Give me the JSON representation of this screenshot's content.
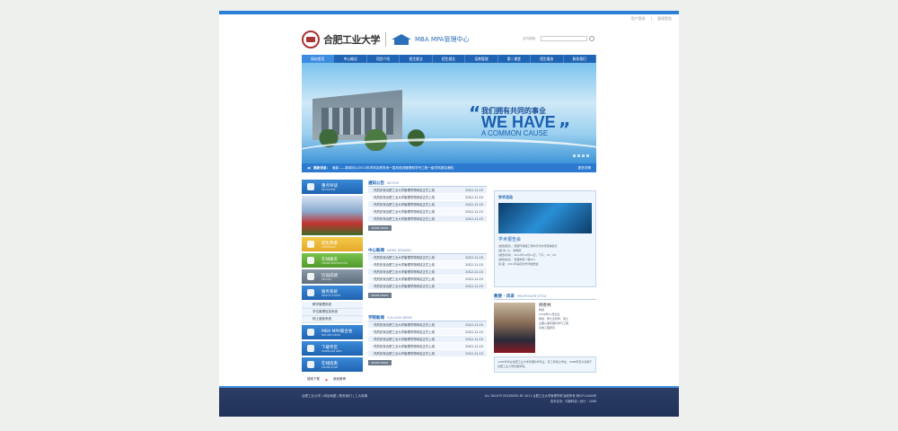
{
  "toplinks": [
    "用户登录",
    "|",
    "管理登陆"
  ],
  "header": {
    "university": "合肥工业大学",
    "center": "MBA MPA管理中心",
    "search_label": "站内搜索："
  },
  "nav": [
    "网站首页",
    "中心概况",
    "项目介绍",
    "招生就业",
    "招生就业",
    "培养管理",
    "第二课堂",
    "招生服务",
    "联系我们"
  ],
  "banner": {
    "slogan_cn": "我们拥有共同的事业",
    "slogan_en_1": "WE HAVE",
    "slogan_en_2": "A COMMON CAUSE",
    "ticker_label": "最新消息：",
    "ticker_text": "最新——新闻中心2012年学科名称查询一直到收到管理和学号工程一级学科报名通知",
    "ticker_more": "更多详情"
  },
  "sidebar": {
    "buttons": [
      {
        "label": "重点导读",
        "sub": "NAVIGATION"
      },
      {
        "label": "招生简章",
        "sub": "ADMISSIONS"
      },
      {
        "label": "在线报名",
        "sub": "ONLINE REGISTRATION"
      },
      {
        "label": "历届成绩",
        "sub": "RESULTS"
      },
      {
        "label": "服务系统",
        "sub": "SERVICE SYSTEM"
      }
    ],
    "subitems": [
      "教学管理系统",
      "学位管理信息系统",
      "网上缴费系统"
    ],
    "buttons2": [
      {
        "label": "MBA MPA联合会",
        "sub": "MBA MPA UNION"
      },
      {
        "label": "下载专区",
        "sub": "DOWNLOAD AREA"
      },
      {
        "label": "在线指南",
        "sub": "ONLINE GUIDE"
      }
    ],
    "share": [
      "搜索下载",
      "新浪微博"
    ]
  },
  "notice": {
    "title": "通知公告",
    "title_en": "NOTICE",
    "rows": [
      {
        "text": "· 热烈庆祝合肥工业大学管理学院网站正式上线",
        "date": "2012-11-15"
      },
      {
        "text": "· 热烈庆祝合肥工业大学管理学院网站正式上线",
        "date": "2012-11-15"
      },
      {
        "text": "· 热烈庆祝合肥工业大学管理学院网站正式上线",
        "date": "2012-11-15"
      },
      {
        "text": "· 热烈庆祝合肥工业大学管理学院网站正式上线",
        "date": "2012-11-15"
      },
      {
        "text": "· 热烈庆祝合肥工业大学管理学院网站正式上线",
        "date": "2012-11-15"
      }
    ],
    "more": "MORE NEWS"
  },
  "news": {
    "title": "中心新闻",
    "title_en": "NEWS DYNAMIC",
    "rows": [
      {
        "text": "· 热烈庆祝合肥工业大学管理学院网站正式上线",
        "date": "2012-11-15"
      },
      {
        "text": "· 热烈庆祝合肥工业大学管理学院网站正式上线",
        "date": "2012-11-15"
      },
      {
        "text": "· 热烈庆祝合肥工业大学管理学院网站正式上线",
        "date": "2012-11-15"
      },
      {
        "text": "· 热烈庆祝合肥工业大学管理学院网站正式上线",
        "date": "2012-11-15"
      },
      {
        "text": "· 热烈庆祝合肥工业大学管理学院网站正式上线",
        "date": "2012-11-15"
      }
    ],
    "more": "MORE NEWS"
  },
  "college": {
    "title": "学院新闻",
    "title_en": "COLLEGE NEWS",
    "rows": [
      {
        "text": "· 热烈庆祝合肥工业大学管理学院网站正式上线",
        "date": "2012-11-15"
      },
      {
        "text": "· 热烈庆祝合肥工业大学管理学院网站正式上线",
        "date": "2012-11-15"
      },
      {
        "text": "· 热烈庆祝合肥工业大学管理学院网站正式上线",
        "date": "2012-11-15"
      },
      {
        "text": "· 热烈庆祝合肥工业大学管理学院网站正式上线",
        "date": "2012-11-15"
      },
      {
        "text": "· 热烈庆祝合肥工业大学管理学院网站正式上线",
        "date": "2012-11-15"
      }
    ],
    "more": "MORE NEWS"
  },
  "activity": {
    "title": "学术活动",
    "name": "学术报告会",
    "lines": [
      "[报告题目]：低碳环保理工场时代与市场营销模式",
      "[报 告 人]：朱教授",
      "[报告时间]：2012年10月11日，下午：15：00",
      "[报告地点]：管理学院一楼101",
      "讲    座：2012年第四次学术报告会"
    ]
  },
  "professor": {
    "title": "教授 · 风采",
    "title_en": "PROFESSOR STYLE",
    "name": "杨善林",
    "role": "教授",
    "lines": [
      "1948年10月出生",
      "教授、博士生导师、院士",
      "主要从事管理科学与工程",
      "系统工程研究"
    ],
    "bio": "1985年毕业合肥工业大学管理科学专业，获工学硕士学位。1988年至今任教于合肥工业大学管理学院。"
  },
  "footer": {
    "left": "合肥工业大学 | 网站地图 | 联系我们 | 工大新闻",
    "right_1": "ALL RIGHTS RESERVED BY 2011 合肥工业大学管理学院  版权所有  皖ICP11060号",
    "right_2": "技术支持：闪赫科技  |  设计：2006"
  }
}
